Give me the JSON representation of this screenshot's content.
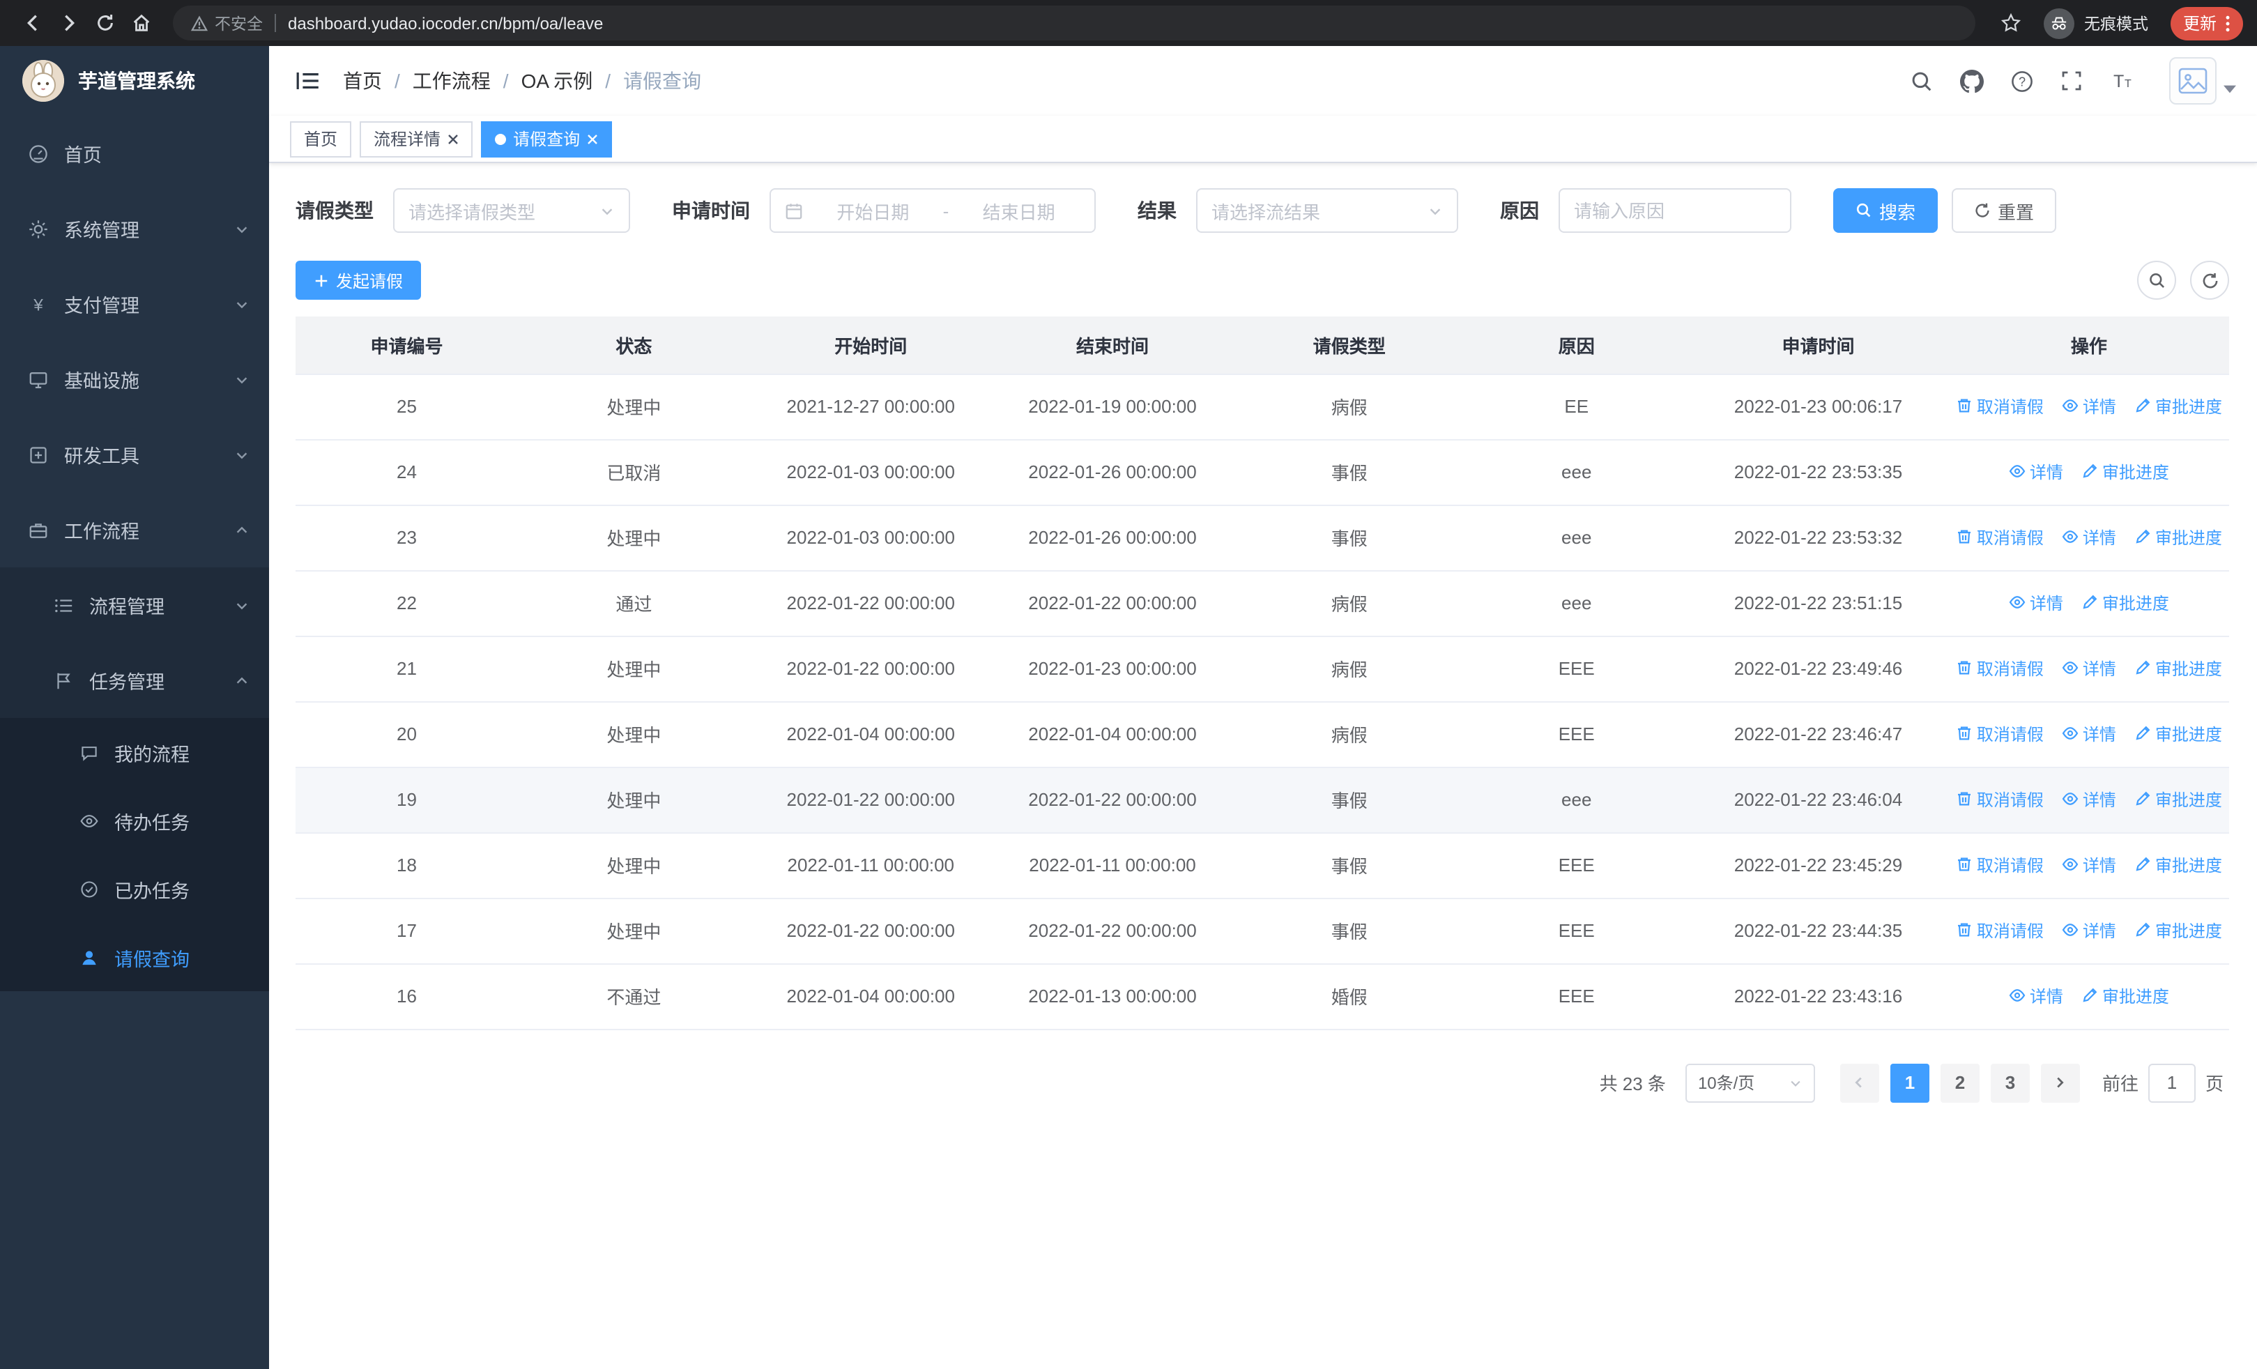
{
  "colors": {
    "primary": "#409eff",
    "sidebar_bg": "#253344",
    "submenu_bg": "#1f2b3a",
    "update_button": "#dd5144"
  },
  "browser": {
    "security_text": "不安全",
    "url": "dashboard.yudao.iocoder.cn/bpm/oa/leave",
    "incognito_text": "无痕模式",
    "update_text": "更新"
  },
  "sidebar": {
    "title": "芋道管理系统",
    "menu": [
      {
        "label": "首页"
      },
      {
        "label": "系统管理"
      },
      {
        "label": "支付管理"
      },
      {
        "label": "基础设施"
      },
      {
        "label": "研发工具"
      },
      {
        "label": "工作流程"
      }
    ],
    "workflow_children": [
      {
        "label": "流程管理"
      },
      {
        "label": "任务管理"
      }
    ],
    "task_children": [
      {
        "label": "我的流程"
      },
      {
        "label": "待办任务"
      },
      {
        "label": "已办任务"
      },
      {
        "label": "请假查询"
      }
    ]
  },
  "header": {
    "breadcrumb": [
      "首页",
      "工作流程",
      "OA 示例",
      "请假查询"
    ],
    "separator": "/"
  },
  "tabs": [
    {
      "label": "首页"
    },
    {
      "label": "流程详情"
    },
    {
      "label": "请假查询"
    }
  ],
  "filters": {
    "leave_type_label": "请假类型",
    "leave_type_placeholder": "请选择请假类型",
    "apply_time_label": "申请时间",
    "start_date_placeholder": "开始日期",
    "range_separator": "-",
    "end_date_placeholder": "结束日期",
    "result_label": "结果",
    "result_placeholder": "请选择流结果",
    "reason_label": "原因",
    "reason_placeholder": "请输入原因",
    "search_label": "搜索",
    "reset_label": "重置"
  },
  "toolbar": {
    "create_label": "发起请假"
  },
  "table": {
    "headers": [
      "申请编号",
      "状态",
      "开始时间",
      "结束时间",
      "请假类型",
      "原因",
      "申请时间",
      "操作"
    ],
    "actions": {
      "cancel": "取消请假",
      "detail": "详情",
      "progress": "审批进度"
    },
    "rows": [
      {
        "id": "25",
        "status": "处理中",
        "start": "2021-12-27 00:00:00",
        "end": "2022-01-19 00:00:00",
        "type": "病假",
        "reason": "EE",
        "applied": "2022-01-23 00:06:17",
        "can_cancel": true
      },
      {
        "id": "24",
        "status": "已取消",
        "start": "2022-01-03 00:00:00",
        "end": "2022-01-26 00:00:00",
        "type": "事假",
        "reason": "eee",
        "applied": "2022-01-22 23:53:35",
        "can_cancel": false
      },
      {
        "id": "23",
        "status": "处理中",
        "start": "2022-01-03 00:00:00",
        "end": "2022-01-26 00:00:00",
        "type": "事假",
        "reason": "eee",
        "applied": "2022-01-22 23:53:32",
        "can_cancel": true
      },
      {
        "id": "22",
        "status": "通过",
        "start": "2022-01-22 00:00:00",
        "end": "2022-01-22 00:00:00",
        "type": "病假",
        "reason": "eee",
        "applied": "2022-01-22 23:51:15",
        "can_cancel": false
      },
      {
        "id": "21",
        "status": "处理中",
        "start": "2022-01-22 00:00:00",
        "end": "2022-01-23 00:00:00",
        "type": "病假",
        "reason": "EEE",
        "applied": "2022-01-22 23:49:46",
        "can_cancel": true
      },
      {
        "id": "20",
        "status": "处理中",
        "start": "2022-01-04 00:00:00",
        "end": "2022-01-04 00:00:00",
        "type": "病假",
        "reason": "EEE",
        "applied": "2022-01-22 23:46:47",
        "can_cancel": true
      },
      {
        "id": "19",
        "status": "处理中",
        "start": "2022-01-22 00:00:00",
        "end": "2022-01-22 00:00:00",
        "type": "事假",
        "reason": "eee",
        "applied": "2022-01-22 23:46:04",
        "can_cancel": true,
        "highlighted": true
      },
      {
        "id": "18",
        "status": "处理中",
        "start": "2022-01-11 00:00:00",
        "end": "2022-01-11 00:00:00",
        "type": "事假",
        "reason": "EEE",
        "applied": "2022-01-22 23:45:29",
        "can_cancel": true
      },
      {
        "id": "17",
        "status": "处理中",
        "start": "2022-01-22 00:00:00",
        "end": "2022-01-22 00:00:00",
        "type": "事假",
        "reason": "EEE",
        "applied": "2022-01-22 23:44:35",
        "can_cancel": true
      },
      {
        "id": "16",
        "status": "不通过",
        "start": "2022-01-04 00:00:00",
        "end": "2022-01-13 00:00:00",
        "type": "婚假",
        "reason": "EEE",
        "applied": "2022-01-22 23:43:16",
        "can_cancel": false
      }
    ]
  },
  "pagination": {
    "total_text": "共 23 条",
    "page_size_text": "10条/页",
    "pages": [
      "1",
      "2",
      "3"
    ],
    "active_page": "1",
    "goto_label": "前往",
    "goto_value": "1",
    "page_unit": "页"
  }
}
